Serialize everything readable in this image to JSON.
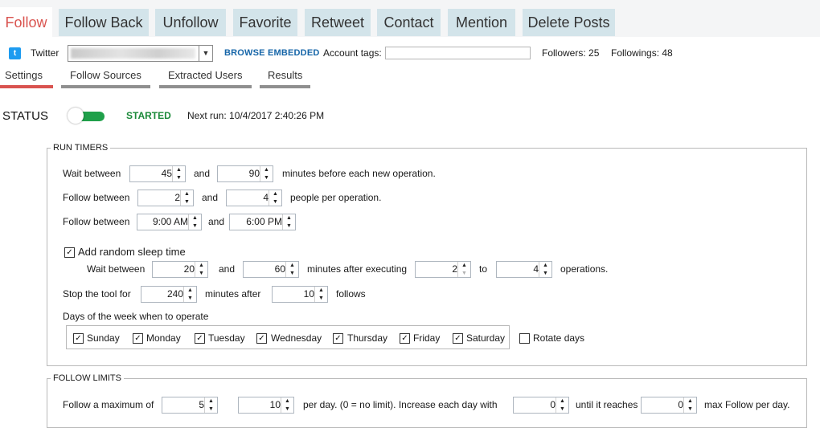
{
  "top_tabs": [
    {
      "label": "Follow",
      "active": true
    },
    {
      "label": "Follow Back"
    },
    {
      "label": "Unfollow"
    },
    {
      "label": "Favorite"
    },
    {
      "label": "Retweet"
    },
    {
      "label": "Contact"
    },
    {
      "label": "Mention"
    },
    {
      "label": "Delete Posts"
    }
  ],
  "account": {
    "platform": "Twitter",
    "browse_embedded": "BROWSE EMBEDDED",
    "account_tags_label": "Account tags:",
    "account_tags_value": "",
    "followers": "Followers: 25",
    "followings": "Followings: 48"
  },
  "sub_tabs": [
    {
      "label": "Settings",
      "active": true
    },
    {
      "label": "Follow Sources"
    },
    {
      "label": "Extracted Users"
    },
    {
      "label": "Results"
    }
  ],
  "status": {
    "title": "STATUS",
    "state": "STARTED",
    "next_run": "Next run: 10/4/2017 2:40:26 PM"
  },
  "run_timers": {
    "title": "RUN TIMERS",
    "row1": {
      "label": "Wait between",
      "v1": "45",
      "and": "and",
      "v2": "90",
      "suffix": "minutes before each new operation."
    },
    "row2": {
      "label": "Follow between",
      "v1": "2",
      "and": "and",
      "v2": "4",
      "suffix": "people per operation."
    },
    "row3": {
      "label": "Follow between",
      "v1": "9:00 AM",
      "and": "and",
      "v2": "6:00 PM"
    },
    "random_sleep": {
      "label": "Add random sleep time",
      "checked": true,
      "wait_label": "Wait between",
      "v1": "20",
      "and": "and",
      "v2": "60",
      "mid": "minutes after executing",
      "v3": "2",
      "to": "to",
      "v4": "4",
      "suffix": "operations."
    },
    "stop": {
      "label": "Stop the tool for",
      "v1": "240",
      "mid": "minutes after",
      "v2": "10",
      "suffix": "follows"
    },
    "days": {
      "label": "Days of the week when to operate",
      "items": [
        {
          "label": "Sunday",
          "checked": true
        },
        {
          "label": "Monday",
          "checked": true
        },
        {
          "label": "Tuesday",
          "checked": true
        },
        {
          "label": "Wednesday",
          "checked": true
        },
        {
          "label": "Thursday",
          "checked": true
        },
        {
          "label": "Friday",
          "checked": true
        },
        {
          "label": "Saturday",
          "checked": true
        }
      ],
      "rotate": {
        "label": "Rotate days",
        "checked": false
      }
    }
  },
  "follow_limits": {
    "title": "FOLLOW LIMITS",
    "label": "Follow a maximum of",
    "v1": "5",
    "v2": "10",
    "mid": "per day. (0 = no limit). Increase each day with",
    "v3": "0",
    "mid2": "until it reaches",
    "v4": "0",
    "suffix": "max Follow per day."
  }
}
